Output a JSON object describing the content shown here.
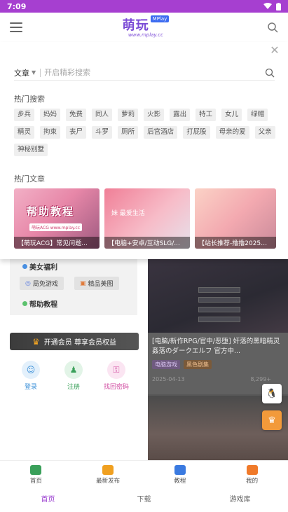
{
  "status": {
    "time": "7:09"
  },
  "header": {
    "logo_main": "萌玩",
    "logo_badge": "MPlay",
    "logo_sub": "www.mplay.cc"
  },
  "search": {
    "type": "文章",
    "placeholder": "开启精彩搜索"
  },
  "hot_search": {
    "title": "热门搜索",
    "tags": [
      "步兵",
      "妈妈",
      "免费",
      "同人",
      "萝莉",
      "火影",
      "露出",
      "特工",
      "女儿",
      "绿帽",
      "精灵",
      "拘束",
      "丧尸",
      "斗罗",
      "厕所",
      "后宫酒店",
      "打屁股",
      "母亲的爱",
      "父亲",
      "神秘别墅"
    ]
  },
  "hot_articles": {
    "title": "热门文章",
    "cards": [
      {
        "caption": "【萌玩ACG】常见问题...",
        "art_text": "帮助教程",
        "mini": "萌玩ACG www.mplay.cc"
      },
      {
        "caption": "【电脑+安卓/互动SLG/...",
        "art_text": "妹 最爱生活"
      },
      {
        "caption": "【站长推荐-撸撸2025已..."
      }
    ]
  },
  "drawer": {
    "benefit": "美女福利",
    "free_games": "局免游戏",
    "gallery": "精品美图",
    "help": "帮助教程",
    "vip": "开通会员 尊享会员权益",
    "login": "登录",
    "register": "注册",
    "recover": "找回密码"
  },
  "feed": {
    "title": "[电脑/新作RPG/官中/恶堕] 奸落的黑暗精灵 姦落のダークエルフ 官方中...",
    "tag1": "电脑游戏",
    "tag2": "黑色剧集",
    "date": "2025-04-13",
    "views": "8,299+"
  },
  "bottom_nav": {
    "items": [
      {
        "label": "首页"
      },
      {
        "label": "最新发布"
      },
      {
        "label": "教程"
      },
      {
        "label": "我的"
      }
    ]
  },
  "tab_bar": {
    "items": [
      {
        "label": "首页"
      },
      {
        "label": "下载"
      },
      {
        "label": "游戏库"
      }
    ]
  },
  "colors": {
    "accent": "#a63fd0",
    "brand": "#7b4bd6"
  }
}
